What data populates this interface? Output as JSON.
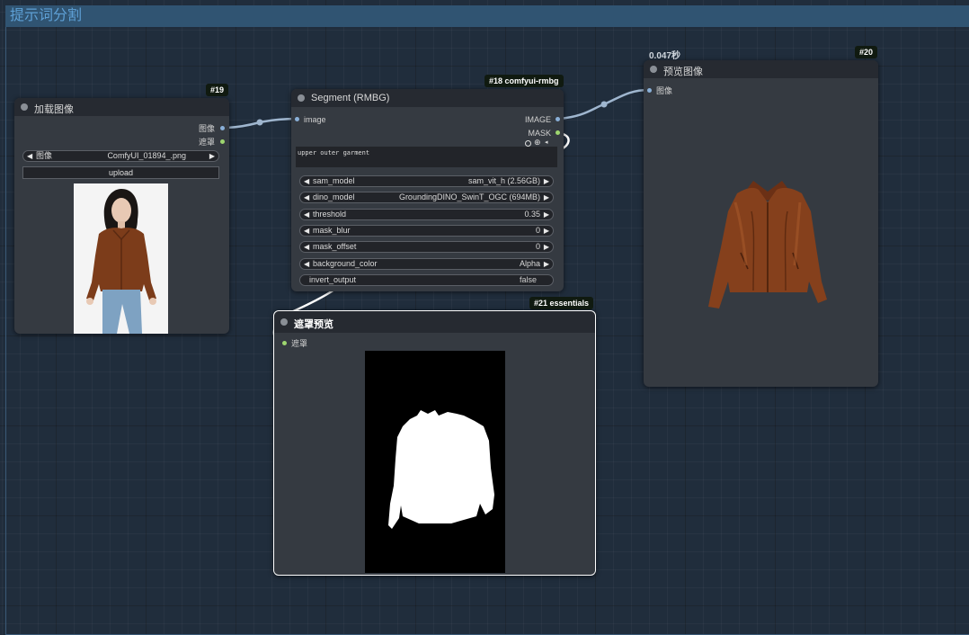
{
  "group": {
    "title": "提示词分割"
  },
  "load_node": {
    "badge": "#19",
    "title": "加载图像",
    "outputs": [
      "图像",
      "遮罩"
    ],
    "image_widget": {
      "label": "图像",
      "value": "ComfyUI_01894_.png"
    },
    "upload_label": "upload"
  },
  "segment_node": {
    "badge": "#18 comfyui-rmbg",
    "title": "Segment (RMBG)",
    "input": "image",
    "outputs": [
      "IMAGE",
      "MASK"
    ],
    "prompt_text": "upper outer garment",
    "widgets": [
      {
        "label": "sam_model",
        "value": "sam_vit_h (2.56GB)"
      },
      {
        "label": "dino_model",
        "value": "GroundingDINO_SwinT_OGC (694MB)"
      },
      {
        "label": "threshold",
        "value": "0.35"
      },
      {
        "label": "mask_blur",
        "value": "0"
      },
      {
        "label": "mask_offset",
        "value": "0"
      },
      {
        "label": "background_color",
        "value": "Alpha"
      }
    ],
    "toggle": {
      "label": "invert_output",
      "value": "false"
    }
  },
  "preview_node": {
    "badge": "#20",
    "time": "0.047秒",
    "title": "预览图像",
    "input": "图像"
  },
  "mask_node": {
    "badge": "#21 essentials",
    "title": "遮罩预览",
    "input": "遮罩"
  },
  "colors": {
    "image_port": "#8ab0d8",
    "mask_port": "#9ed66f",
    "link": "#9fb6cf",
    "group_header": "#305472",
    "canvas": "#202d3c"
  }
}
